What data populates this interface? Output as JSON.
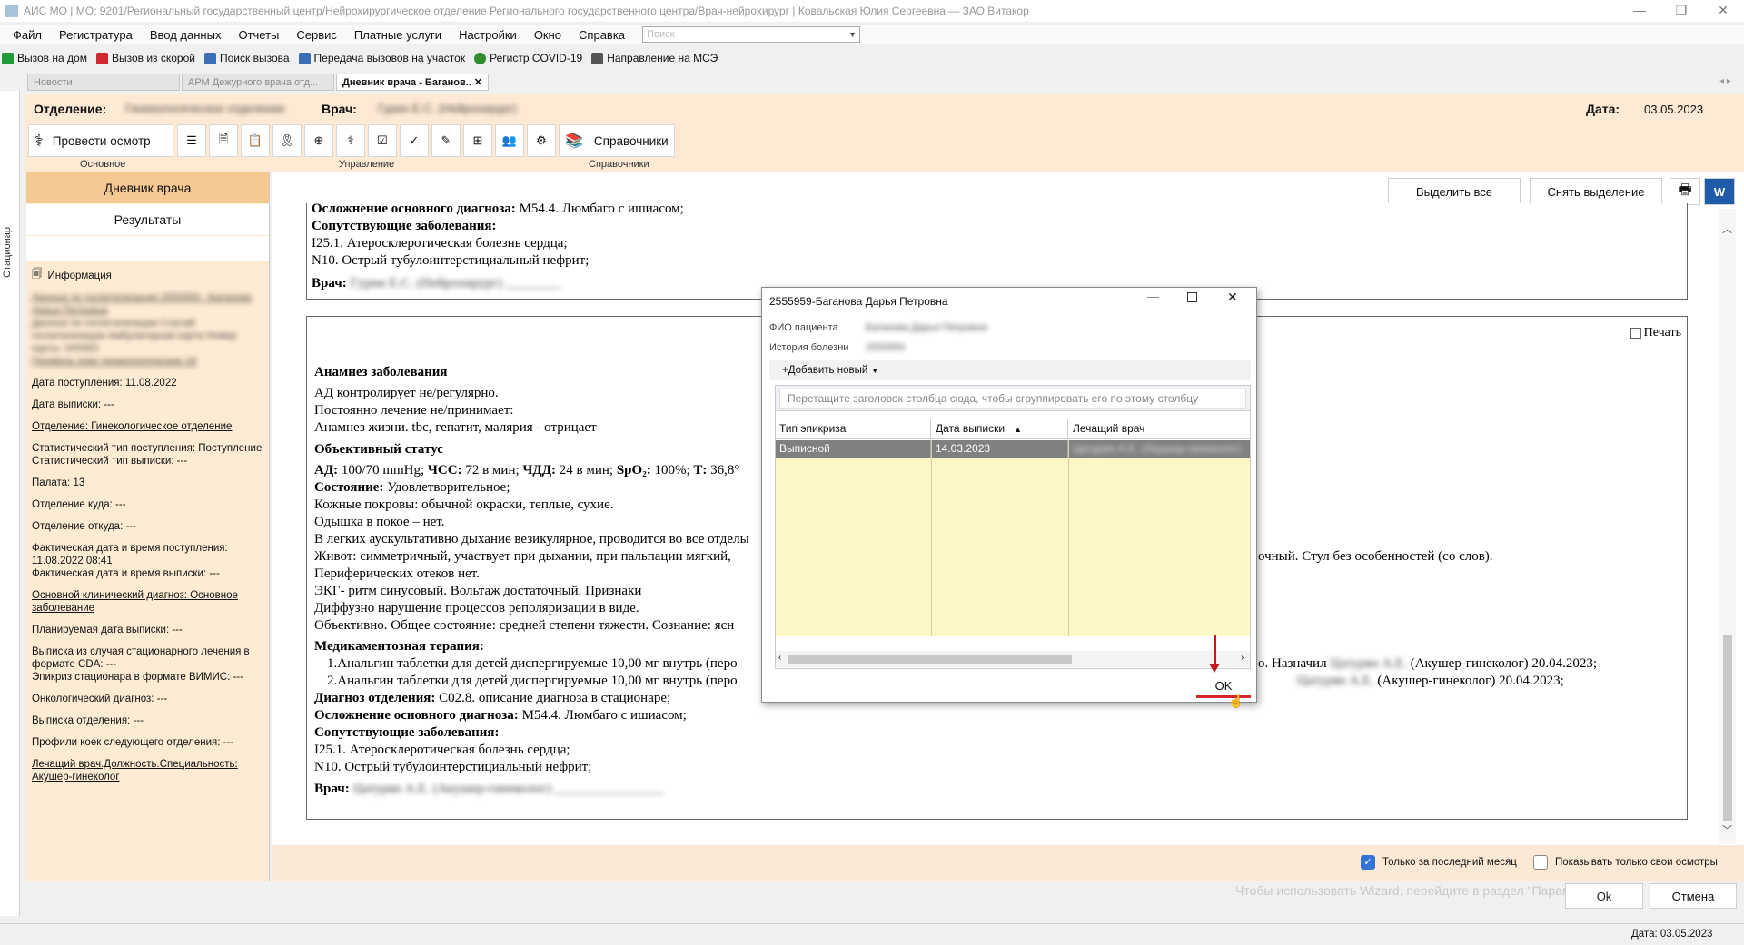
{
  "window": {
    "title": "АИС МО | МО: 9201/Региональный государственный центр/Нейрохирургическое отделение Регионального государственного центра/Врач-нейрохирург | Ковальская Юлия Сергеевна — ЗАО Витакор",
    "min": "—",
    "max": "❐",
    "close": "✕"
  },
  "menu": {
    "items": [
      "Файл",
      "Регистратура",
      "Ввод данных",
      "Отчеты",
      "Сервис",
      "Платные услуги",
      "Настройки",
      "Окно",
      "Справка"
    ],
    "search_placeholder": "Поиск"
  },
  "quickbar": {
    "items": [
      {
        "label": "Вызов на дом",
        "color": "#1e9a3a"
      },
      {
        "label": "Вызов из скорой",
        "color": "#d0282e"
      },
      {
        "label": "Поиск вызова",
        "color": "#3b6fb5"
      },
      {
        "label": "Передача вызовов на участок",
        "color": "#3b6fb5"
      },
      {
        "label": "Регистр COVID-19",
        "color": "#2e8b2e"
      },
      {
        "label": "Направление на МСЭ",
        "color": "#555555"
      }
    ]
  },
  "tabs": [
    {
      "label": "Новости"
    },
    {
      "label": "АРМ Дежурного врача отд..."
    },
    {
      "label": "Дневник врача - Баганов..."
    }
  ],
  "sidestrip": "Стационар",
  "header": {
    "dept_label": "Отделение:",
    "dept_value": "Гинекологическое отделение",
    "doctor_label": "Врач:",
    "doctor_value": "Гурин Е.С. (Нейрохирург)",
    "date_label": "Дата:",
    "date_value": "03.05.2023",
    "exam_button": "Провести осмотр",
    "group_main": "Основное",
    "group_manage": "Управление",
    "group_refs": "Справочники",
    "refs_button": "Справочники"
  },
  "left": {
    "nav1": "Дневник врача",
    "nav2": "Результаты",
    "info_title": "Информация",
    "blurred": [
      "Данные по госпитализации 2555959 - Баганова Дарья Петровна",
      "Данные по госпитализации Случай госпитализации Амбулаторная карта Номер карты: 345983",
      "Профиль коек гинекологические 18"
    ],
    "lines": [
      {
        "t": "Дата поступления: 11.08.2022",
        "u": false
      },
      {
        "t": "Дата выписки: ---",
        "u": false
      },
      {
        "t": "Отделение: Гинекологическое отделение",
        "u": true
      },
      {
        "t": "Статистический тип поступления: Поступление\nСтатистический тип выписки: ---",
        "u": false
      },
      {
        "t": "Палата: 13",
        "u": false
      },
      {
        "t": "Отделение куда: ---",
        "u": false
      },
      {
        "t": "Отделение откуда: ---",
        "u": false
      },
      {
        "t": "Фактическая дата и время поступления: 11.08.2022 08:41\nФактическая дата и время выписки: ---",
        "u": false
      },
      {
        "t": "Основной клинический диагноз: Основное заболевание",
        "u": true
      },
      {
        "t": "Планируемая дата выписки: ---",
        "u": false
      },
      {
        "t": "Выписка из случая стационарного лечения в формате CDA: ---\nЭпикриз стационара в формате ВИМИС: ---",
        "u": false
      },
      {
        "t": "Онкологический диагноз: ---",
        "u": false
      },
      {
        "t": "Выписка отделения: ---",
        "u": false
      },
      {
        "t": "Профили коек следующего отделения: ---",
        "u": false
      },
      {
        "t": "Лечащий врач.Должность.Специальность: Акушер-гинеколог",
        "u": true
      }
    ]
  },
  "toolbar_right": {
    "select_all": "Выделить все",
    "deselect": "Снять выделение"
  },
  "doc1": {
    "line0": "Осложнение основного диагноза: М54.4. Люмбаго с ишиасом;",
    "l0b": "Осложнение основного диагноза:",
    "l0r": " М54.4. Люмбаго с ишиасом;",
    "comorb": "Сопутствующие заболевания:",
    "c1": "I25.1. Атеросклеротическая болезнь сердца;",
    "c2": "N10. Острый тубулоинтерстициальный нефрит;",
    "doctor_label": "Врач:",
    "doctor_value": "Гурин Е.С. (Нейрохирург) ________"
  },
  "doc2": {
    "print_label": "Печать",
    "anamnesis": "Анамнез заболевания",
    "a1": "АД контролирует не/регулярно.",
    "a2": "Постоянно лечение не/принимает:",
    "a3": "Анамнез жизни.  tbc, гепатит, малярия - отрицает",
    "objective": "Объективный статус",
    "vitals_ad": "АД:",
    "vitals_ad_v": " 100/70 mmHg; ",
    "vitals_hr": "ЧСС:",
    "vitals_hr_v": " 72 в мин; ",
    "vitals_rr": "ЧДД:",
    "vitals_rr_v": " 24 в мин; ",
    "vitals_spo": "SpO₂:",
    "vitals_spo_v": " 100%; ",
    "vitals_t": "Т:",
    "vitals_t_v": " 36,8°",
    "state_label": "Состояние:",
    "state_value": " Удовлетворительное;",
    "o1": "Кожные покровы: обычной окраски, теплые, сухие.",
    "o2": "Одышка в покое – нет.",
    "o3": "В легких аускультативно дыхание везикулярное, проводится во все отделы",
    "o4": "Живот: симметричный, участвует при дыхании, при пальпации мягкий,",
    "o4r": "очный. Стул без особенностей (со слов).",
    "o5": " Периферических отеков нет.",
    "o6": "ЭКГ- ритм синусовый. Вольтаж достаточный. Признаки",
    "o7": "Диффузно нарушение процессов реполяризации в виде.",
    "o8": "Объективно. Общее состояние: средней степени тяжести. Сознание: ясн",
    "therapy": "Медикаментозная терапия:",
    "t1": "1.Анальгин таблетки для детей диспергируемые 10,00 мг внутрь (перо",
    "t1r": "о. Назначил",
    "t1b": "Цатурян А.Е.",
    "t1r2": " (Акушер-гинеколог) 20.04.2023;",
    "t2": "2.Анальгин таблетки для детей диспергируемые 10,00 мг внутрь (перо",
    "t2b": "Цатурян А.Е.",
    "t2r2": " (Акушер-гинеколог) 20.04.2023;",
    "dx_label": "Диагноз отделения:",
    "dx_value": " С02.8. описание диагноза в стационаре;",
    "cx_label": "Осложнение основного диагноза:",
    "cx_value": " М54.4. Люмбаго с ишиасом;",
    "comorb": "Сопутствующие заболевания:",
    "c1": "I25.1. Атеросклеротическая болезнь сердца;",
    "c2": "N10. Острый тубулоинтерстициальный нефрит;",
    "doctor_label": "Врач:",
    "doctor_value": "Цатурян А.Е. (Акушер-гинеколог) ________________"
  },
  "bottom": {
    "last_month": "Только за последний месяц",
    "own_only": "Показывать только свои осмотры",
    "hint": "Чтобы использовать Wizard, перейдите в раздел \"Параметры\"",
    "ok": "Ok",
    "cancel": "Отмена"
  },
  "status": {
    "date": "Дата: 03.05.2023"
  },
  "dialog": {
    "title": "2555959-Баганова Дарья Петровна",
    "fio_label": "ФИО пациента",
    "fio_value": "Баганова Дарья Петровна",
    "history_label": "История болезни",
    "history_value": "2555959",
    "add_new": "+Добавить новый",
    "group_hint": "Перетащите заголовок столбца сюда, чтобы сгруппировать его по этому столбцу",
    "columns": [
      "Тип эпикриза",
      "Дата выписки",
      "Лечащий врач"
    ],
    "rows": [
      [
        "Выписной",
        "14.03.2023",
        "Цатурян А.Е. (Акушер-гинеколог)"
      ]
    ],
    "ok": "OK"
  }
}
